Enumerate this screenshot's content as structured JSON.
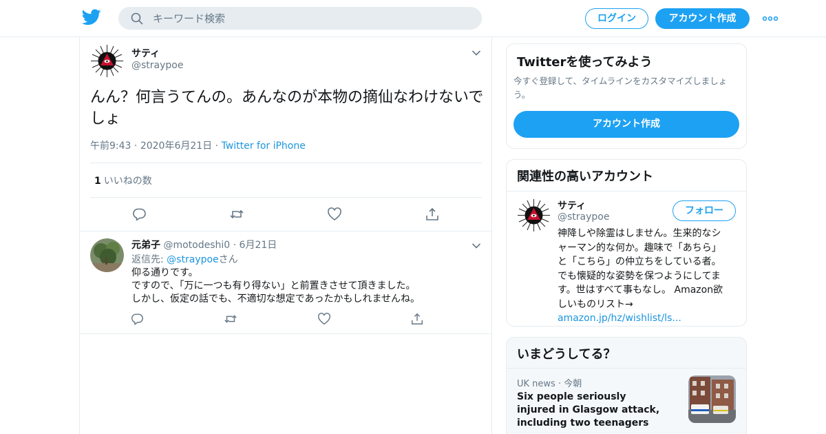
{
  "header": {
    "search_placeholder": "キーワード検索",
    "login_label": "ログイン",
    "signup_label": "アカウント作成"
  },
  "colors": {
    "accent": "#1da1f2",
    "link": "#1b95e0",
    "muted": "#657786",
    "border": "#e6ecf0"
  },
  "icons": [
    "twitter-bird-icon",
    "search-icon",
    "more-dots-icon",
    "chevron-down-icon",
    "reply-icon",
    "retweet-icon",
    "like-icon",
    "share-icon"
  ],
  "tweet": {
    "name": "サティ",
    "handle": "@straypoe",
    "text": "んん？何言うてんの。あんなのが本物の摘仙なわけないでしょ",
    "time": "午前9:43",
    "dot1": "·",
    "date": "2020年6月21日",
    "dot2": "·",
    "source": "Twitter for iPhone",
    "like_count": "1",
    "like_label": "いいねの数"
  },
  "reply": {
    "name": "元弟子",
    "handle": "@motodeshi0",
    "dot": "·",
    "date": "6月21日",
    "reply_to_prefix": "返信先: ",
    "reply_to_handle": "@straypoe",
    "reply_to_suffix": "さん",
    "lines": [
      "仰る通りです。",
      "ですので、「万に一つも有り得ない」と前置きさせて頂きました。",
      "しかし、仮定の話でも、不適切な想定であったかもしれませんね。"
    ]
  },
  "sidebar": {
    "signup_card": {
      "title": "Twitterを使ってみよう",
      "desc": "今すぐ登録して、タイムラインをカスタマイズしましょう。",
      "button": "アカウント作成"
    },
    "related": {
      "title": "関連性の高いアカウント",
      "name": "サティ",
      "handle": "@straypoe",
      "follow": "フォロー",
      "bio_lines": [
        "神降しや除霊はしません。生来的なシ",
        "ャーマン的な何か。趣味で「あちら」",
        "と「こちら」の仲立ちをしている者。",
        "でも懐疑的な姿勢を保つようにしてま",
        "す。世はすべて事もなし。 Amazon欲",
        "しいものリスト→"
      ],
      "bio_link": "amazon.jp/hz/wishlist/ls..."
    },
    "trends": {
      "title": "いまどうしてる？",
      "source": "UK news",
      "dot": "·",
      "time": "今朝",
      "headline": "Six people seriously injured in Glasgow attack, including two teenagers"
    }
  }
}
